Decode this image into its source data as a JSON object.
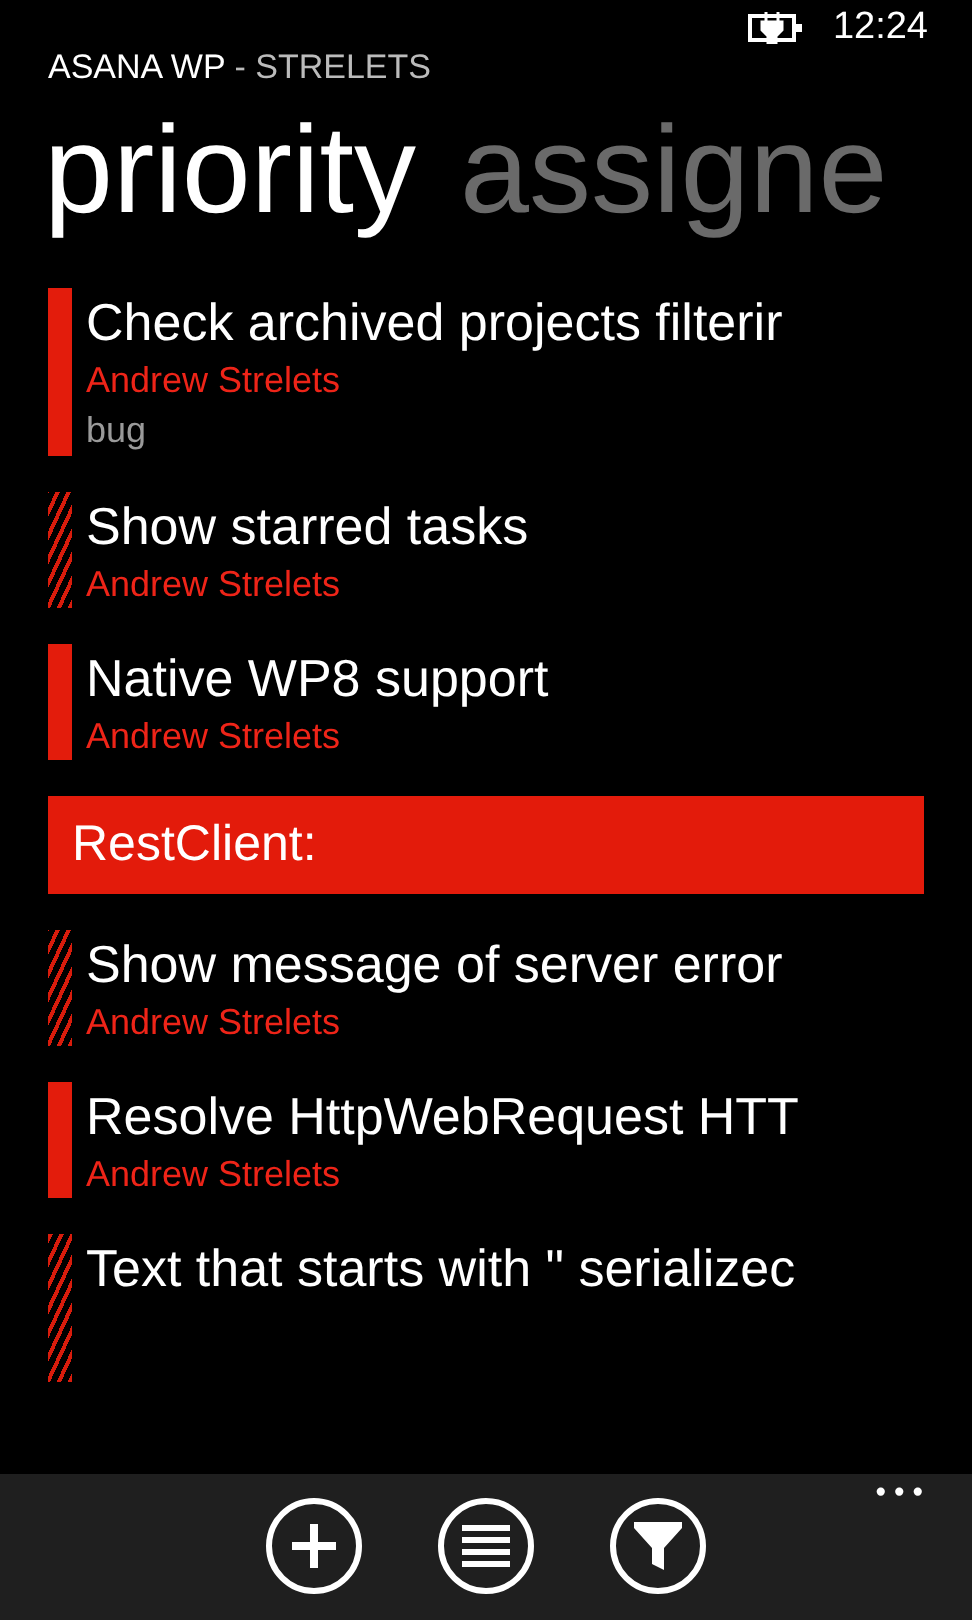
{
  "status_bar": {
    "time": "12:24"
  },
  "app_title": {
    "name": "ASANA WP",
    "suffix": " - STRELETS"
  },
  "pivot": [
    {
      "label": "priority",
      "selected": true
    },
    {
      "label": "assigne",
      "selected": false
    }
  ],
  "items": [
    {
      "kind": "task",
      "hatched": false,
      "title": "Check archived projects filterir",
      "assignee": "Andrew Strelets",
      "tag": "bug"
    },
    {
      "kind": "task",
      "hatched": true,
      "title": "Show starred tasks",
      "assignee": "Andrew Strelets"
    },
    {
      "kind": "task",
      "hatched": false,
      "title": "Native WP8 support",
      "assignee": "Andrew Strelets"
    },
    {
      "kind": "section",
      "title": "RestClient:"
    },
    {
      "kind": "task",
      "hatched": true,
      "title": "Show message of server error",
      "assignee": "Andrew Strelets"
    },
    {
      "kind": "task",
      "hatched": false,
      "title": "Resolve HttpWebRequest HTT",
      "assignee": "Andrew Strelets"
    },
    {
      "kind": "task",
      "hatched": true,
      "title": "Text that starts with \" serializec"
    }
  ],
  "app_bar": {
    "buttons": [
      {
        "kind": "add"
      },
      {
        "kind": "list"
      },
      {
        "kind": "filter"
      }
    ],
    "more": "•••"
  }
}
